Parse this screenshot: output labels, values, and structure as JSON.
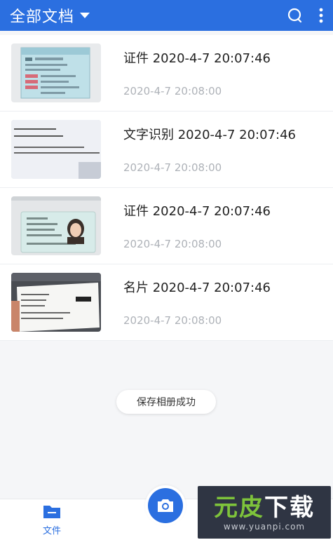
{
  "header": {
    "title": "全部文档",
    "icons": [
      "chevron-down-icon",
      "search-icon",
      "more-vert-icon"
    ]
  },
  "documents": [
    {
      "title": "证件 2020-4-7 20:07:46",
      "date": "2020-4-7 20:08:00",
      "thumbnail": "driver-license"
    },
    {
      "title": "文字识别 2020-4-7 20:07:46",
      "date": "2020-4-7 20:08:00",
      "thumbnail": "text-page"
    },
    {
      "title": "证件 2020-4-7 20:07:46",
      "date": "2020-4-7 20:08:00",
      "thumbnail": "id-card"
    },
    {
      "title": "名片 2020-4-7 20:07:46",
      "date": "2020-4-7 20:08:00",
      "thumbnail": "business-card"
    }
  ],
  "toast": {
    "message": "保存相册成功"
  },
  "bottom_nav": {
    "files_label": "文件",
    "camera_icon": "camera-icon"
  },
  "watermark": {
    "brand": "元皮下载",
    "url": "www.yuanpi.com"
  },
  "colors": {
    "accent": "#2b6fe0",
    "date_text": "#aeb2b8",
    "background": "#f5f6f8"
  }
}
